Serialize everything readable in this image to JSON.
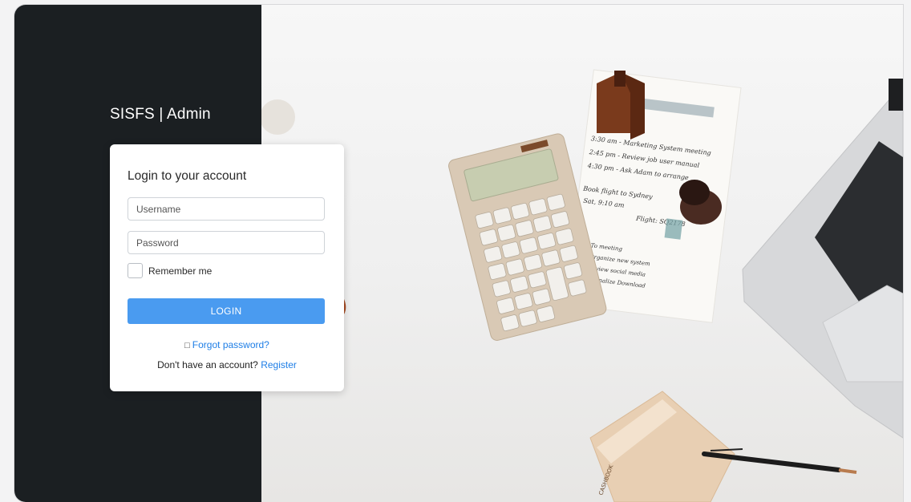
{
  "brand": {
    "title": "SISFS | Admin"
  },
  "login_card": {
    "heading": "Login to your account",
    "username_placeholder": "Username",
    "password_placeholder": "Password",
    "remember_label": "Remember me",
    "login_button": "LOGIN",
    "forgot_icon": "□",
    "forgot_link": "Forgot password?",
    "signup_text": "Don't have an account?",
    "register_link": "Register"
  },
  "hero_image": {
    "subject": "desk-with-calculator-notes-laptop-pen",
    "note_lines": [
      "3:30 am - Marketing System meeting",
      "2:45 pm - Review job user manual",
      "4:30 pm - Ask Adam to arrange",
      "Book flight to Sydney",
      "Sat, 9:10 am",
      "Flight: SQ2178",
      "To meeting",
      "Organize new system",
      "Review social media",
      "Finalize Download"
    ],
    "book_label": "CASHBOOK"
  },
  "colors": {
    "panel": "#1b1f22",
    "button": "#4a9bf0",
    "link": "#1e7ee6"
  }
}
